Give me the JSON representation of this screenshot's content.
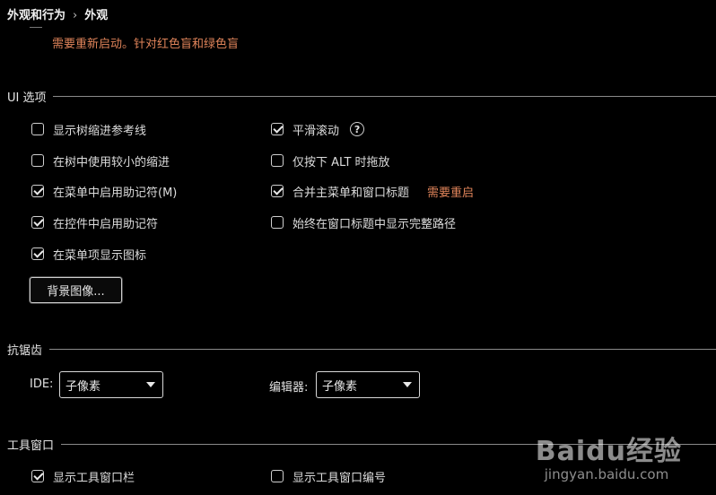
{
  "breadcrumb": {
    "parent": "外观和行为",
    "current": "外观"
  },
  "restart_note": "需要重新启动。针对红色盲和绿色盲",
  "ui_options": {
    "title": "UI 选项",
    "left": [
      {
        "label": "显示树缩进参考线",
        "checked": false
      },
      {
        "label": "在树中使用较小的缩进",
        "checked": false
      },
      {
        "label": "在菜单中启用助记符(M)",
        "checked": true
      },
      {
        "label": "在控件中启用助记符",
        "checked": true
      },
      {
        "label": "在菜单项显示图标",
        "checked": true
      }
    ],
    "right": [
      {
        "label": "平滑滚动",
        "checked": true,
        "help": "?"
      },
      {
        "label": "仅按下 ALT 时拖放",
        "checked": false
      },
      {
        "label": "合并主菜单和窗口标题",
        "checked": true,
        "note": "需要重启"
      },
      {
        "label": "始终在窗口标题中显示完整路径",
        "checked": false
      }
    ],
    "background_button": "背景图像..."
  },
  "antialiasing": {
    "title": "抗锯齿",
    "ide_label": "IDE:",
    "ide_value": "子像素",
    "editor_label": "编辑器:",
    "editor_value": "子像素"
  },
  "tool_windows": {
    "title": "工具窗口",
    "options": [
      {
        "label": "显示工具窗口栏",
        "checked": true
      },
      {
        "label": "显示工具窗口编号",
        "checked": false
      }
    ]
  },
  "watermark": {
    "brand": "Baidu经验",
    "url": "jingyan.baidu.com"
  },
  "colors": {
    "background": "#000000",
    "text": "#dcdcdc",
    "warning": "#e0845a"
  }
}
